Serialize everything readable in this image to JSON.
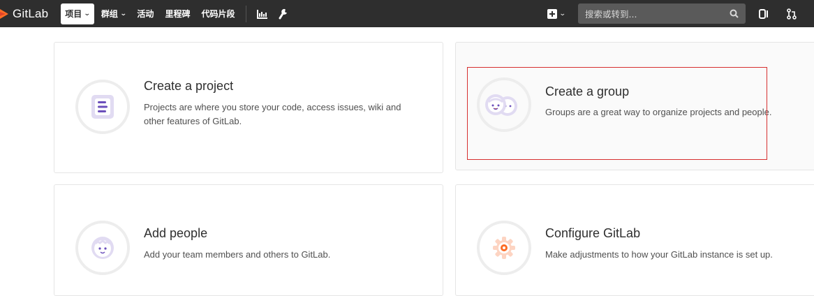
{
  "navbar": {
    "brand": "GitLab",
    "items": [
      {
        "label": "项目",
        "active": true,
        "dropdown": true
      },
      {
        "label": "群组",
        "active": false,
        "dropdown": true
      },
      {
        "label": "活动",
        "active": false,
        "dropdown": false
      },
      {
        "label": "里程碑",
        "active": false,
        "dropdown": false
      },
      {
        "label": "代码片段",
        "active": false,
        "dropdown": false
      }
    ],
    "icons": [
      "chart-icon",
      "wrench-icon"
    ],
    "search_placeholder": "搜索或转到..."
  },
  "cards": [
    {
      "title": "Create a project",
      "desc": "Projects are where you store your code, access issues, wiki and other features of GitLab.",
      "icon": "project-icon"
    },
    {
      "title": "Create a group",
      "desc": "Groups are a great way to organize projects and people.",
      "icon": "group-icon"
    },
    {
      "title": "Add people",
      "desc": "Add your team members and others to GitLab.",
      "icon": "people-icon"
    },
    {
      "title": "Configure GitLab",
      "desc": "Make adjustments to how your GitLab instance is set up.",
      "icon": "settings-icon"
    }
  ],
  "colors": {
    "navbar": "#2e2e2e",
    "accent_purple": "#6b4fbb",
    "accent_orange": "#fc6d26",
    "highlight": "#d62f2f"
  }
}
